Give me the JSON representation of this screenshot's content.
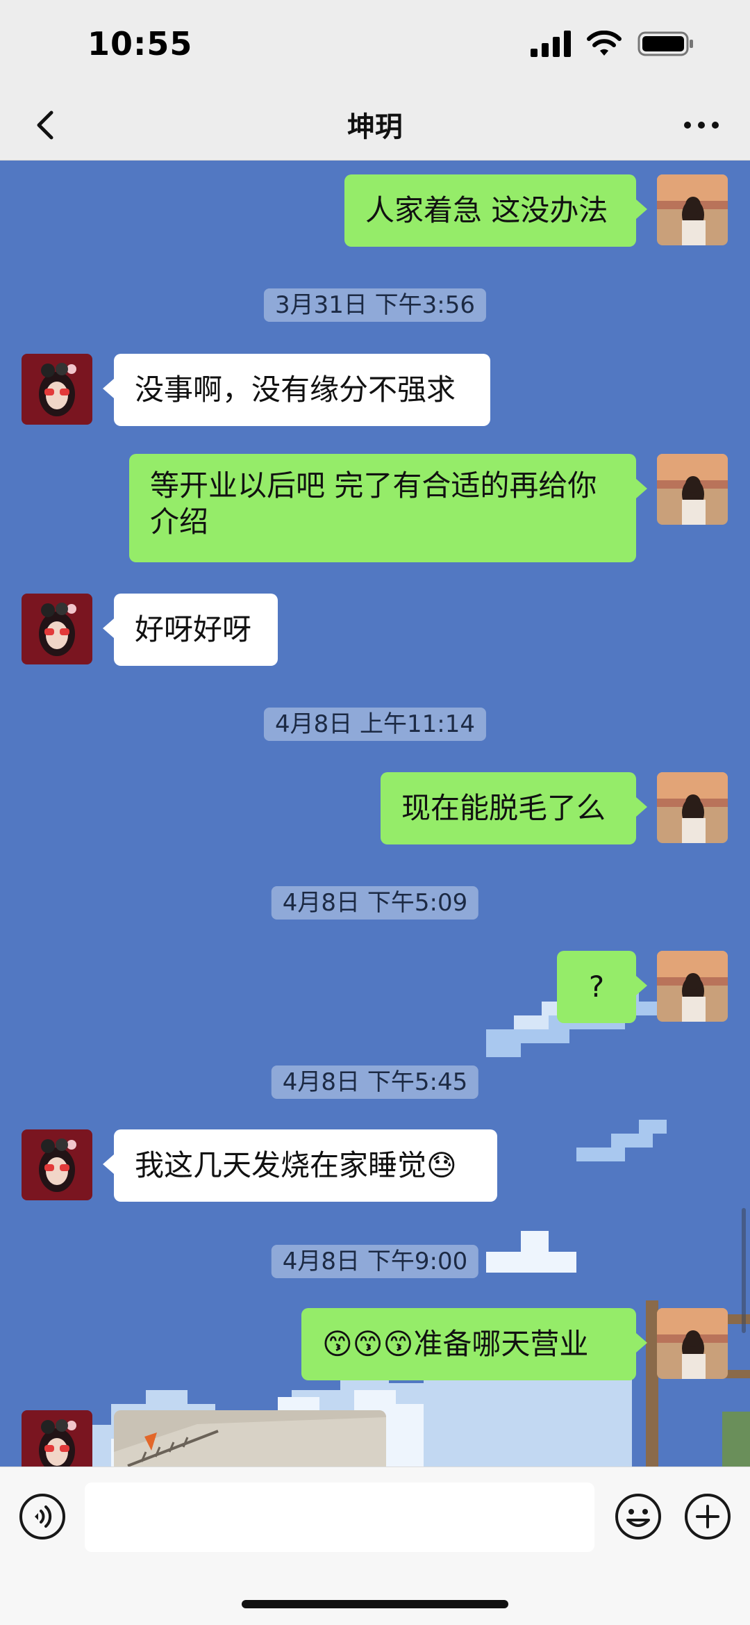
{
  "status": {
    "time": "10:55"
  },
  "header": {
    "title": "坤玥"
  },
  "messages": [
    {
      "type": "text",
      "from": "me",
      "text": "人家着急 这没办法"
    },
    {
      "type": "time",
      "text": "3月31日 下午3:56"
    },
    {
      "type": "text",
      "from": "other",
      "text": "没事啊，没有缘分不强求"
    },
    {
      "type": "text",
      "from": "me",
      "text": "等开业以后吧 完了有合适的再给你介绍"
    },
    {
      "type": "text",
      "from": "other",
      "text": "好呀好呀"
    },
    {
      "type": "time",
      "text": "4月8日 上午11:14"
    },
    {
      "type": "text",
      "from": "me",
      "text": "现在能脱毛了么"
    },
    {
      "type": "time",
      "text": "4月8日 下午5:09"
    },
    {
      "type": "text",
      "from": "me",
      "text": "?"
    },
    {
      "type": "time",
      "text": "4月8日 下午5:45"
    },
    {
      "type": "text",
      "from": "other",
      "text": "我这几天发烧在家睡觉😓"
    },
    {
      "type": "time",
      "text": "4月8日 下午9:00"
    },
    {
      "type": "text",
      "from": "me",
      "text": "😙😙😙准备哪天营业"
    },
    {
      "type": "image",
      "from": "other"
    }
  ],
  "input": {
    "value": "",
    "placeholder": ""
  },
  "icons": {
    "back": "chevron-left-icon",
    "more": "more-icon",
    "voice": "voice-icon",
    "emoji": "emoji-icon",
    "plus": "plus-icon"
  },
  "colors": {
    "chat_background": "#5278c2",
    "my_bubble": "#95ec69",
    "their_bubble": "#ffffff",
    "header_background": "#ededed"
  }
}
